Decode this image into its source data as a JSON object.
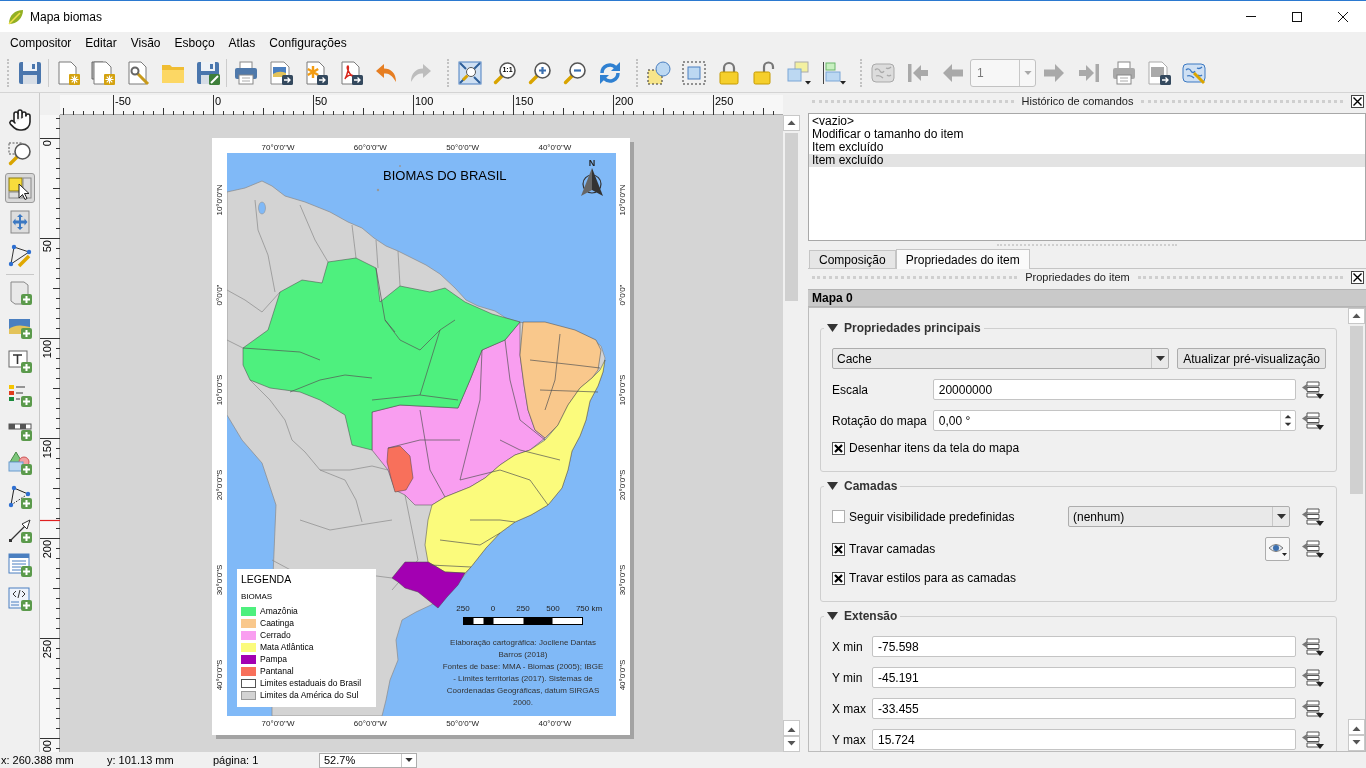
{
  "window": {
    "title": "Mapa biomas"
  },
  "menu": [
    "Compositor",
    "Editar",
    "Visão",
    "Esboço",
    "Atlas",
    "Configurações"
  ],
  "toolbar": {
    "redo": {
      "disabled": true
    },
    "zoom_actual_size_glyph": "1:1",
    "atlas": {
      "disabled": true,
      "page": "1"
    }
  },
  "tool_palette": [
    {
      "selected": false
    },
    {
      "selected": false
    },
    {
      "selected": true
    },
    {
      "selected": false
    },
    {
      "selected": false
    },
    {
      "selected": false
    },
    {
      "selected": false
    },
    {
      "selected": false
    },
    {
      "selected": false
    },
    {
      "selected": false
    },
    {
      "selected": false
    },
    {
      "selected": false
    },
    {
      "selected": false
    },
    {
      "selected": false
    },
    {
      "selected": false
    }
  ],
  "rulers": {
    "horizontal": [
      "-50",
      "0",
      "50",
      "100",
      "150",
      "200",
      "250"
    ],
    "vertical": [
      "0",
      "50",
      "100",
      "150",
      "200",
      "250",
      "00"
    ]
  },
  "layout_page": {
    "grid_labels": {
      "top": [
        "70°0'0\"W",
        "60°0'0\"W",
        "50°0'0\"W",
        "40°0'0\"W"
      ],
      "bottom": [
        "70°0'0\"W",
        "60°0'0\"W",
        "50°0'0\"W",
        "40°0'0\"W"
      ],
      "left": [
        "10°0'0\"N",
        "0°0'0\"",
        "10°0'0\"S",
        "20°0'0\"S",
        "30°0'0\"S",
        "40°0'0\"S"
      ],
      "right": [
        "10°0'0\"N",
        "0°0'0\"",
        "10°0'0\"S",
        "20°0'0\"S",
        "30°0'0\"S",
        "40°0'0\"S"
      ]
    },
    "map": {
      "title": "BIOMAS DO BRASIL",
      "north_label": "N",
      "legend": {
        "title": "LEGENDA",
        "group": "BIOMAS",
        "items": [
          {
            "label": "Amazônia",
            "kind": "fill",
            "color": "#4ef07e"
          },
          {
            "label": "Caatinga",
            "kind": "fill",
            "color": "#f9c88c"
          },
          {
            "label": "Cerrado",
            "kind": "fill",
            "color": "#f99ef0"
          },
          {
            "label": "Mata Atlântica",
            "kind": "fill",
            "color": "#fbfb7c"
          },
          {
            "label": "Pampa",
            "kind": "fill",
            "color": "#a300b2"
          },
          {
            "label": "Pantanal",
            "kind": "fill",
            "color": "#f8705b"
          },
          {
            "label": "Limites estaduais do Brasil",
            "kind": "outline",
            "color": "#555555"
          },
          {
            "label": "Limites da América do Sul",
            "kind": "region",
            "color": "#d3d3d3"
          }
        ]
      },
      "scale_bar": {
        "labels": [
          "250",
          "0",
          "250",
          "500",
          "750 km"
        ]
      },
      "credits": [
        "Elaboração cartográfica: Jocilene Dantas Barros (2018)",
        "Fontes de base: MMA - Biomas (2005); IBGE - Limites territorias (2017). Sistemas de Coordenadas Geográficas, datum SIRGAS 2000."
      ]
    }
  },
  "history_panel": {
    "title": "Histórico de comandos",
    "items": [
      {
        "label": "<vazio>",
        "selected": false
      },
      {
        "label": "Modificar o tamanho do item",
        "selected": false
      },
      {
        "label": "Item excluído",
        "selected": false
      },
      {
        "label": "Item excluído",
        "selected": true
      }
    ]
  },
  "tabs": [
    {
      "label": "Composição",
      "selected": false
    },
    {
      "label": "Propriedades do item",
      "selected": true
    }
  ],
  "item_properties": {
    "title": "Propriedades do item",
    "item_name": "Mapa 0",
    "groups": [
      {
        "title": "Propriedades principais",
        "expanded": true,
        "rows": [
          {
            "kind": "combo_with_button",
            "value": "Cache",
            "button": "Atualizar pré-visualização"
          },
          {
            "kind": "field",
            "label": "Escala",
            "value": "20000000"
          },
          {
            "kind": "spinbox",
            "label": "Rotação do mapa",
            "value": "0,00 °"
          },
          {
            "kind": "checkbox",
            "label": "Desenhar itens da tela do mapa",
            "checked": true
          }
        ]
      },
      {
        "title": "Camadas",
        "expanded": true,
        "rows": [
          {
            "kind": "checkbox_combo",
            "label": "Seguir visibilidade predefinidas",
            "checked": false,
            "value": "(nenhum)"
          },
          {
            "kind": "checkbox_eye",
            "label": "Travar camadas",
            "checked": true
          },
          {
            "kind": "checkbox",
            "label": "Travar estilos para as camadas",
            "checked": true
          }
        ]
      },
      {
        "title": "Extensão",
        "expanded": true,
        "rows": [
          {
            "kind": "field",
            "label": "X min",
            "value": "-75.598"
          },
          {
            "kind": "field",
            "label": "Y min",
            "value": "-45.191"
          },
          {
            "kind": "field",
            "label": "X max",
            "value": "-33.455"
          },
          {
            "kind": "field",
            "label": "Y max",
            "value": "15.724"
          }
        ]
      }
    ]
  },
  "status_bar": {
    "x": "x: 260.388 mm",
    "y": "y: 101.13 mm",
    "page": "página: 1",
    "zoom": "52.7%"
  }
}
